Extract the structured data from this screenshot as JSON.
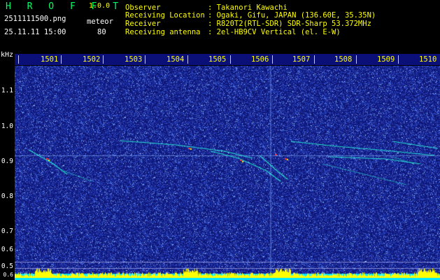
{
  "header": {
    "brand": "H R O F F T",
    "version": "1.0.0",
    "filename": "2511111500.png",
    "timestamp": "25.11.11 15:00",
    "mode": "meteor",
    "count": "80"
  },
  "station_info": [
    {
      "label": "Observer",
      "value": ": Takanori Kawachi"
    },
    {
      "label": "Receiving Location",
      "value": ": Ogaki, Gifu, JAPAN (136.60E, 35.35N)"
    },
    {
      "label": "Receiver",
      "value": ": R820T2(RTL-SDR) SDR-Sharp 53.372MHz"
    },
    {
      "label": "Receiving antenna",
      "value": ": 2el-HB9CV Vertical (el. E-W)"
    }
  ],
  "frequency_axis": {
    "unit": "kHz",
    "labels": [
      "1.1",
      "1.0",
      "0.9",
      "0.8",
      "0.7",
      "0.6",
      "0.5",
      "0.6"
    ]
  },
  "time_axis": {
    "labels": [
      "1501",
      "1502",
      "1503",
      "1504",
      "1505",
      "1506",
      "1507",
      "1508",
      "1509",
      "1510"
    ]
  },
  "colors": {
    "background": "#000000",
    "waterfall_noise": "#1a2aa0",
    "meteor_trace": "#00ffcc",
    "meteor_peak": "#ff3030",
    "label_yellow": "#ffff00",
    "brand_green": "#00ff66",
    "level_bar": "#00e8ff",
    "level_peak": "#ffff00"
  }
}
